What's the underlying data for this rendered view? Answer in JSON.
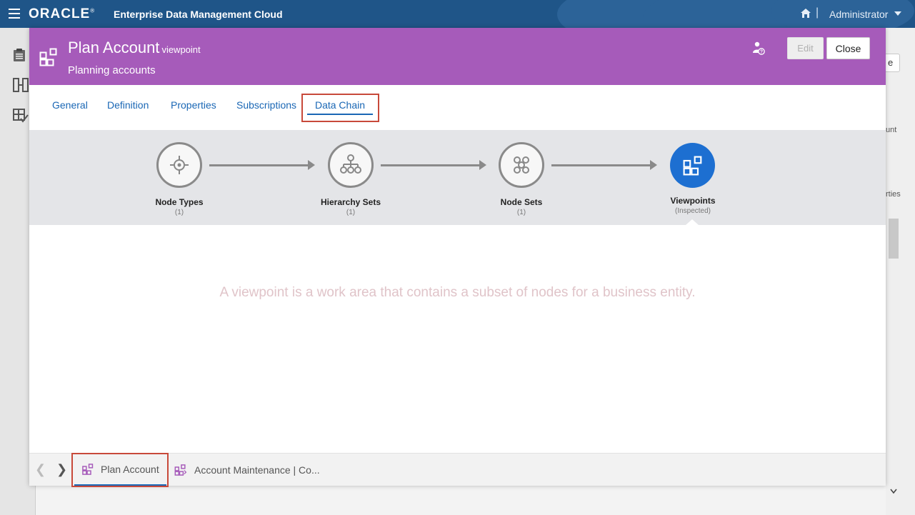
{
  "topbar": {
    "brand": "ORACLE",
    "brand_mark": "®",
    "product": "Enterprise Data Management Cloud",
    "user": "Administrator"
  },
  "background": {
    "button_fragment": "e",
    "text_1": "unt",
    "text_2": "rties"
  },
  "modal": {
    "title": "Plan Account",
    "title_suffix": "viewpoint",
    "subtitle": "Planning accounts",
    "edit_label": "Edit",
    "close_label": "Close",
    "header_color": "#a65bba"
  },
  "tabs": [
    {
      "label": "General",
      "active": false
    },
    {
      "label": "Definition",
      "active": false
    },
    {
      "label": "Properties",
      "active": false
    },
    {
      "label": "Subscriptions",
      "active": false
    },
    {
      "label": "Data Chain",
      "active": true
    }
  ],
  "chain": [
    {
      "label": "Node Types",
      "count": "(1)",
      "icon": "node-type-icon"
    },
    {
      "label": "Hierarchy Sets",
      "count": "(1)",
      "icon": "hierarchy-icon"
    },
    {
      "label": "Node Sets",
      "count": "(1)",
      "icon": "node-set-icon"
    },
    {
      "label": "Viewpoints",
      "count": "(Inspected)",
      "icon": "viewpoint-icon",
      "active": true
    }
  ],
  "description": "A viewpoint is a work area that contains a subset of nodes for a business entity.",
  "footer": {
    "tabs": [
      {
        "label": "Plan Account",
        "active": true
      },
      {
        "label": "Account Maintenance | Co..."
      }
    ]
  },
  "colors": {
    "accent": "#1a67b5",
    "active_node": "#1d6fd1",
    "highlight": "#c8493a",
    "topbar": "#1f5588"
  }
}
